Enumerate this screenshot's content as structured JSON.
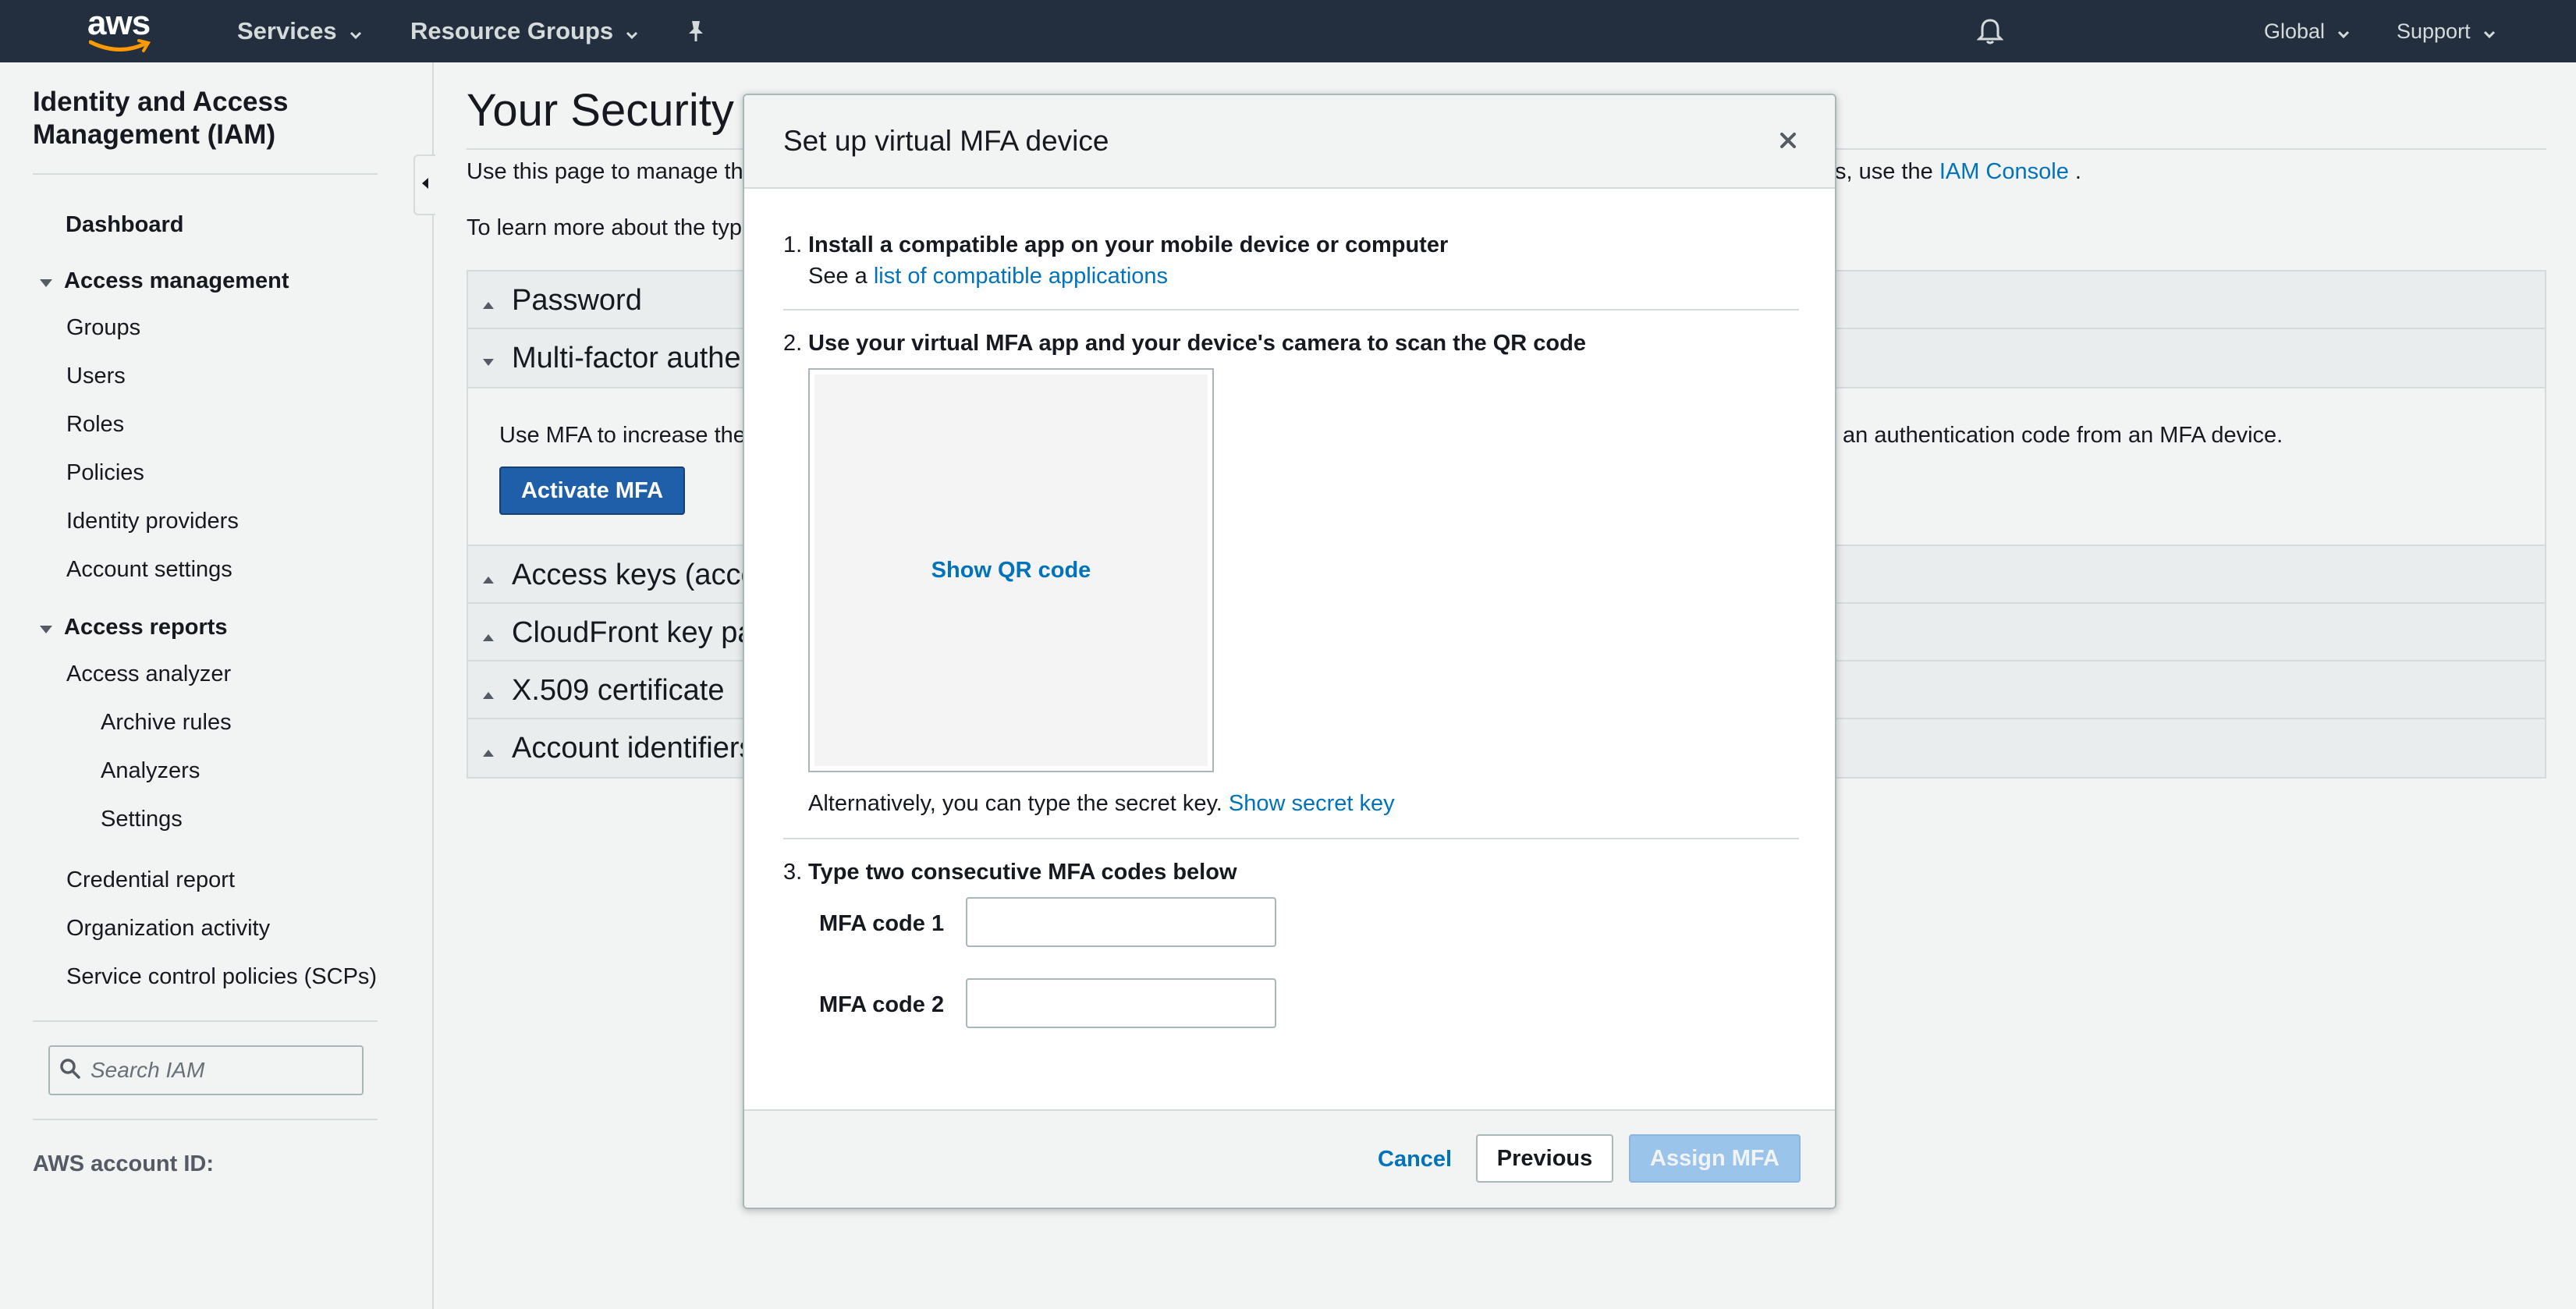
{
  "topnav": {
    "logo_text": "aws",
    "services_label": "Services",
    "resource_groups_label": "Resource Groups",
    "region_label": "Global",
    "support_label": "Support"
  },
  "sidebar": {
    "title": "Identity and Access Management (IAM)",
    "dashboard": "Dashboard",
    "access_management": {
      "label": "Access management",
      "items": [
        "Groups",
        "Users",
        "Roles",
        "Policies",
        "Identity providers",
        "Account settings"
      ]
    },
    "access_reports": {
      "label": "Access reports",
      "items": [
        "Access analyzer"
      ],
      "subitems": [
        "Archive rules",
        "Analyzers",
        "Settings"
      ],
      "more_items": [
        "Credential report",
        "Organization activity",
        "Service control policies (SCPs)"
      ]
    },
    "search_placeholder": "Search IAM",
    "account_id_label": "AWS account ID:"
  },
  "main": {
    "title": "Your Security C",
    "desc1_left": "Use this page to manage the",
    "desc1_right_prefix": "s, use the ",
    "desc1_link": "IAM Console",
    "desc1_suffix": " .",
    "desc2": "To learn more about the type",
    "sections": [
      {
        "label": "Password"
      },
      {
        "label": "Multi-factor auther"
      },
      {
        "label": "Access keys (acce"
      },
      {
        "label": "CloudFront key pa"
      },
      {
        "label": "X.509 certificate"
      },
      {
        "label": "Account identifiers"
      }
    ],
    "mfa_text_left": "Use MFA to increase the",
    "mfa_text_right": "an authentication code from an MFA device.",
    "activate_button": "Activate MFA"
  },
  "modal": {
    "title": "Set up virtual MFA device",
    "close_glyph": "×",
    "step1": {
      "num": "1.",
      "title": "Install a compatible app on your mobile device or computer",
      "sub_prefix": "See a ",
      "sub_link": "list of compatible applications"
    },
    "step2": {
      "num": "2.",
      "title": "Use your virtual MFA app and your device's camera to scan the QR code",
      "qr_link": "Show QR code",
      "alt_text": "Alternatively, you can type the secret key. ",
      "alt_link": "Show secret key"
    },
    "step3": {
      "num": "3.",
      "title": "Type two consecutive MFA codes below",
      "code1_label": "MFA code 1",
      "code1_value": "",
      "code2_label": "MFA code 2",
      "code2_value": ""
    },
    "footer": {
      "cancel": "Cancel",
      "previous": "Previous",
      "assign": "Assign MFA"
    }
  },
  "colors": {
    "nav_bg": "#232f3e",
    "link": "#0073bb",
    "primary_button": "#1f5ea8",
    "disabled_button": "#9bc4ea"
  }
}
